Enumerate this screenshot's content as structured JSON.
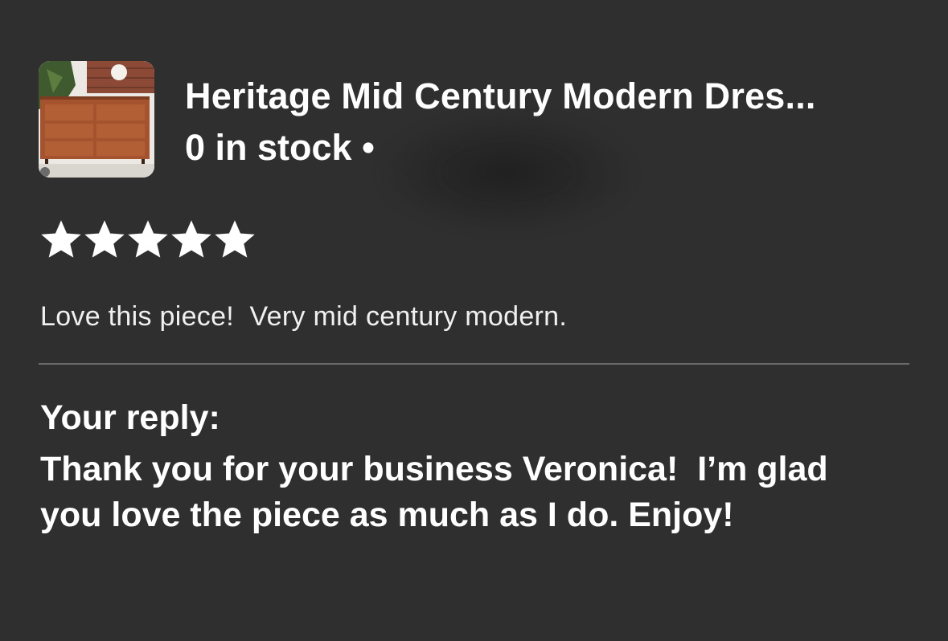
{
  "product": {
    "title": "Heritage  Mid Century Modern Dres...",
    "stock_text": "0 in stock •",
    "thumbnail_icon": "dresser-photo"
  },
  "rating": {
    "value": 5,
    "max": 5,
    "star_color": "#ffffff"
  },
  "review": {
    "text": "Love this piece!  Very mid century modern."
  },
  "reply": {
    "label": "Your reply:",
    "text": "Thank you for your business Veronica!  I’m glad you love the piece as much as I do. Enjoy!"
  },
  "colors": {
    "background": "#2f2f2f",
    "text": "#ffffff",
    "divider": "#6a6a6a"
  }
}
